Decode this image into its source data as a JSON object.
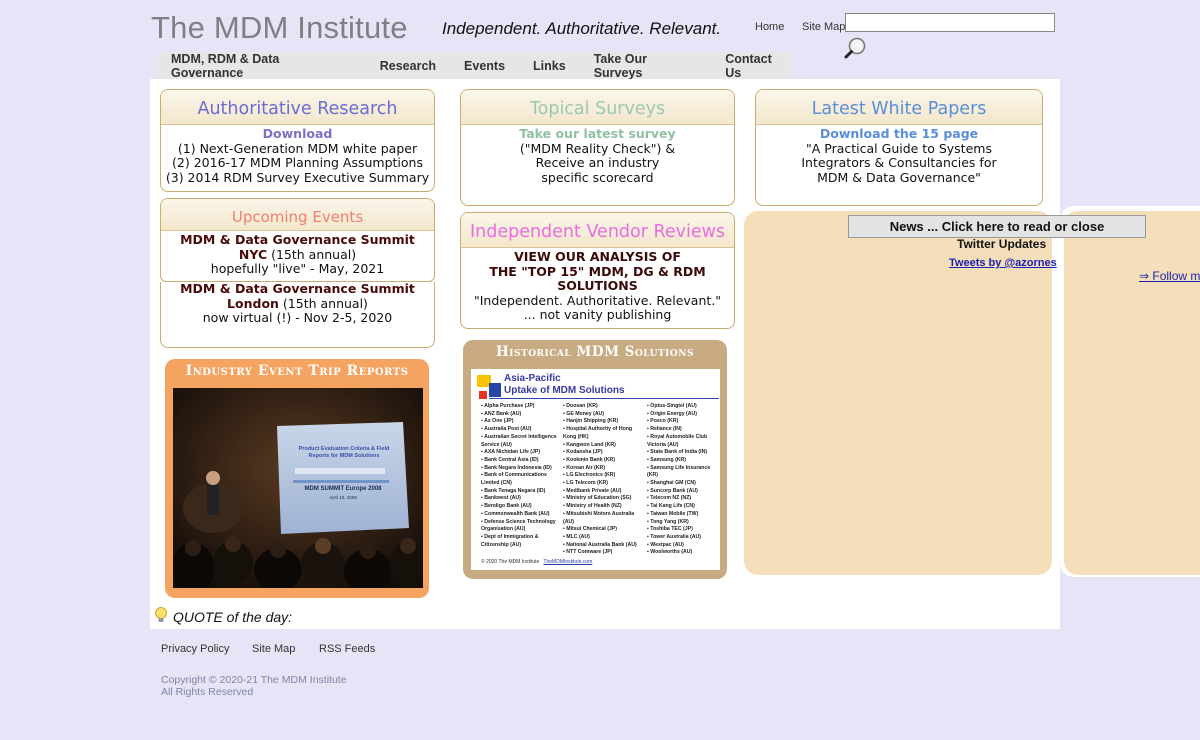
{
  "header": {
    "logo": "The MDM Institute",
    "tagline": "Independent. Authoritative. Relevant.",
    "home": "Home",
    "site_map": "Site Map"
  },
  "nav": [
    "MDM, RDM & Data Governance",
    "Research",
    "Events",
    "Links",
    "Take Our Surveys",
    "Contact Us"
  ],
  "research": {
    "title": "Authoritative Research",
    "download": "Download",
    "lines": [
      "(1) Next-Generation MDM white paper",
      "(2) 2016-17 MDM Planning Assumptions",
      "(3) 2014 RDM Survey Executive Summary"
    ]
  },
  "surveys": {
    "title": "Topical Surveys",
    "link": "Take our latest survey",
    "lines": [
      "(\"MDM Reality Check\") &",
      "Receive an industry",
      "specific scorecard"
    ]
  },
  "white_papers": {
    "title": "Latest White Papers",
    "link": "Download the 15 page",
    "lines": [
      "\"A Practical Guide to Systems",
      "Integrators & Consultancies for",
      "MDM & Data Governance\""
    ]
  },
  "events": {
    "title": "Upcoming Events",
    "e1_name": "MDM & Data Governance Summit",
    "e1_city": "NYC",
    "e1_note": " (15th annual)",
    "e1_date": "hopefully \"live\" - May, 2021",
    "e2_name": "MDM & Data Governance Summit",
    "e2_city": "London",
    "e2_note": " (15th annual)",
    "e2_date": "now virtual (!) - Nov 2-5, 2020"
  },
  "vendor_reviews": {
    "title": "Independent Vendor Reviews",
    "bold1": "VIEW OUR ANALYSIS OF",
    "bold2": "THE \"TOP 15\" MDM, DG & RDM",
    "bold3": "SOLUTIONS",
    "line1": "\"Independent. Authoritative. Relevant.\"",
    "line2": "... not vanity publishing"
  },
  "trip_reports": {
    "title": "Industry Event Trip Reports",
    "slide_title": "Product Evaluation Criteria & Field Reports for MDM Solutions",
    "slide_event": "MDM SUMMIT Europe 2008",
    "slide_date": "April 15, 2008"
  },
  "historical": {
    "title": "Historical MDM Solutions",
    "map_title1": "Asia-Pacific",
    "map_title2": "Uptake of MDM Solutions",
    "col1": [
      "Alpha Purchase (JP)",
      "ANZ Bank (AU)",
      "As One (JP)",
      "Australia Post (AU)",
      "Australian Secret Intelligence Service (AU)",
      "AXA Nichidan Life (JP)",
      "Bank Central Asia (ID)",
      "Bank Negara Indonesia (ID)",
      "Bank of Communications Limited (CN)",
      "Bank Tenaga Negara (ID)",
      "Bankwest (AU)",
      "Bendigo Bank (AU)",
      "Commonwealth Bank (AU)",
      "Defense Science Technology Organisation (AU)",
      "Dept of Immigration & Citizenship (AU)"
    ],
    "col2": [
      "Doosan (KR)",
      "GE Money (AU)",
      "Hanjin Shipping (KR)",
      "Hospital Authority of Hong Kong (HK)",
      "Kangwon Land (KR)",
      "Kodansha (JP)",
      "Kookmin Bank (KR)",
      "Korean Air (KR)",
      "LG Electronics (KR)",
      "LG Telecom (KR)",
      "Medibank Private (AU)",
      "Ministry of Education (SG)",
      "Ministry of Health (NZ)",
      "Mitsubishi Motors Australia (AU)",
      "Mitsui Chemical (JP)",
      "MLC (AU)",
      "National Australia Bank (AU)",
      "NTT Comware (JP)"
    ],
    "col3": [
      "Optus-Singtel (AU)",
      "Origin Energy (AU)",
      "Posco (KR)",
      "Reliance (IN)",
      "Royal Automobile Club Victoria (AU)",
      "State Bank of India (IN)",
      "Samsung (KR)",
      "Samsung Life Insurance (KR)",
      "Shanghai GM (CN)",
      "Suncorp Bank (AU)",
      "Telecom NZ (NZ)",
      "Tai Kang Life (CN)",
      "Taiwan Mobile (TW)",
      "Tong Yang (KR)",
      "Toshiba TEC (JP)",
      "Tower Australia (AU)",
      "Westpac (AU)",
      "Woolworths (AU)"
    ],
    "footnote1": "© 2020 The MDM Institute",
    "footnote2": "TheMDMInstitute.com"
  },
  "news": {
    "bar": "News ... Click here to read or close",
    "twitter_heading": "Twitter Updates",
    "tweets_link": "Tweets by @azornes",
    "follow": "⇒ Follow m"
  },
  "quote": {
    "label": "QUOTE of the day:"
  },
  "footer": {
    "privacy": "Privacy Policy",
    "site_map": "Site Map",
    "rss": "RSS Feeds",
    "copyright1": "Copyright © 2020-21 The MDM Institute",
    "copyright2": "All Rights Reserved"
  },
  "colors": {
    "background": "#e7e4f7",
    "research_title": "#6b6bd4",
    "surveys_title": "#9ac8b0",
    "white_papers_title": "#5a8fd8",
    "events_title": "#f08070",
    "vendor_title": "#ea6ce0",
    "events_text": "#4a0a0a",
    "tan_panel": "#f5deba",
    "orange_box": "#f4a361",
    "brown_box": "#c8ab82"
  }
}
